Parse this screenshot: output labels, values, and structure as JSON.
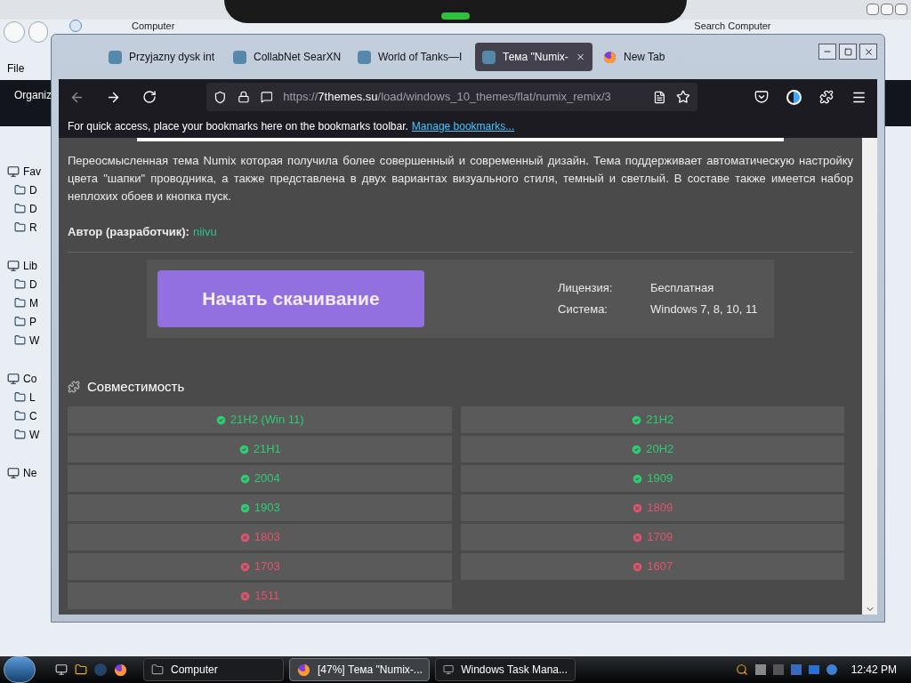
{
  "explorer": {
    "address": "Computer",
    "search": {
      "placeholder": "Search Computer"
    },
    "menu": [
      "File"
    ],
    "toolbar": [
      "Organiz"
    ],
    "nav": [
      {
        "label": "Fav",
        "children": [
          {
            "label": "D"
          },
          {
            "label": "D"
          },
          {
            "label": "R"
          }
        ]
      },
      {
        "label": "Lib",
        "children": [
          {
            "label": "D"
          },
          {
            "label": "M"
          },
          {
            "label": "P"
          },
          {
            "label": "W"
          }
        ]
      },
      {
        "label": "Co",
        "children": [
          {
            "label": "L"
          },
          {
            "label": "C"
          },
          {
            "label": "W"
          }
        ]
      },
      {
        "label": "Ne"
      }
    ]
  },
  "browser": {
    "tabs": [
      {
        "label": "Przyjazny dysk int",
        "selected": false
      },
      {
        "label": "CollabNet SearXN",
        "selected": false
      },
      {
        "label": "World of Tanks—I",
        "selected": false
      },
      {
        "label": "Тема \"Numix-",
        "selected": true
      },
      {
        "label": "New Tab",
        "selected": false
      }
    ],
    "url": {
      "scheme": "https://",
      "host": "7themes.su",
      "path": "/load/windows_10_themes/flat/numix_remix/3"
    },
    "bookmarks_hint": "For quick access, place your bookmarks here on the bookmarks toolbar.",
    "bookmarks_link": "Manage bookmarks...",
    "page": {
      "description": "Переосмысленная тема Numix которая получила более совершенный и современный дизайн. Тема поддерживает автоматическую настройку цвета \"шапки\" проводника, а также представлена в двух вариантах визуального стиля, темный и светлый. В составе также имеется набор неплохих обоев и кнопка пуск.",
      "author_label": "Автор (разработчик):",
      "author": "niivu",
      "download": "Начать скачивание",
      "info": [
        {
          "label": "Лицензия:",
          "value": "Бесплатная"
        },
        {
          "label": "Система:",
          "value": "Windows 7, 8, 10, 11"
        }
      ],
      "compat_title": "Совместимость",
      "compat": [
        {
          "label": "21H2 (Win 11)",
          "ok": true
        },
        {
          "label": "21H2",
          "ok": true
        },
        {
          "label": "21H1",
          "ok": true
        },
        {
          "label": "20H2",
          "ok": true
        },
        {
          "label": "2004",
          "ok": true
        },
        {
          "label": "1909",
          "ok": true
        },
        {
          "label": "1903",
          "ok": true
        },
        {
          "label": "1809",
          "ok": false
        },
        {
          "label": "1803",
          "ok": false
        },
        {
          "label": "1709",
          "ok": false
        },
        {
          "label": "1703",
          "ok": false
        },
        {
          "label": "1607",
          "ok": false
        },
        {
          "label": "1511",
          "ok": false
        }
      ]
    }
  },
  "taskbar": {
    "buttons": [
      {
        "label": "Computer",
        "selected": false,
        "kind": "folder"
      },
      {
        "label": "[47%] Тема \"Numix-...",
        "selected": true,
        "kind": "firefox"
      },
      {
        "label": "Windows Task Mana...",
        "selected": false,
        "kind": "task"
      }
    ],
    "clock": "12:42 PM"
  }
}
